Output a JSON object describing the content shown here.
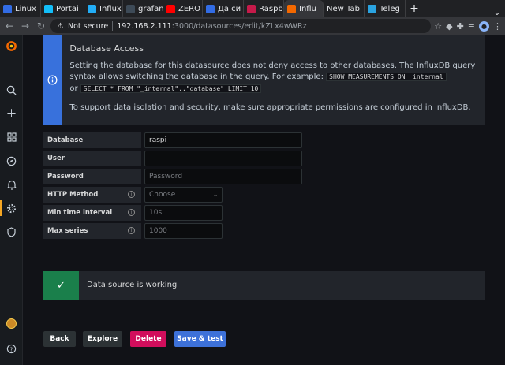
{
  "browser": {
    "tabs": [
      {
        "label": "Linux",
        "icon": "k8s-icon",
        "color": "#326ce5"
      },
      {
        "label": "Portai",
        "icon": "portainer-icon",
        "color": "#13bef9"
      },
      {
        "label": "Influx",
        "icon": "influx-icon",
        "color": "#22adf6"
      },
      {
        "label": "grafan",
        "icon": "grafana-icon",
        "color": "#3d4a57"
      },
      {
        "label": "ZERO",
        "icon": "youtube-icon",
        "color": "#ff0000"
      },
      {
        "label": "Да си",
        "icon": "k8s-icon",
        "color": "#326ce5"
      },
      {
        "label": "Raspb",
        "icon": "raspberry-icon",
        "color": "#c51a4a"
      },
      {
        "label": "Influ",
        "icon": "grafana-icon",
        "color": "#f46800"
      },
      {
        "label": "New Tab",
        "icon": "",
        "color": ""
      },
      {
        "label": "Teleg",
        "icon": "telegram-icon",
        "color": "#2aa3e0"
      }
    ],
    "new_tab_symbol": "+",
    "security_label": "Not secure",
    "url_host": "192.168.2.111",
    "url_path": ":3000/datasources/edit/kZLx4wWRz"
  },
  "info_alert": {
    "title": "Database Access",
    "line1": "Setting the database for this datasource does not deny access to other databases. The InfluxDB query syntax allows switching the database in the query. For example:",
    "code1": "SHOW MEASUREMENTS ON _internal",
    "or_text": "or",
    "code2": "SELECT * FROM \"_internal\"..\"database\" LIMIT 10",
    "line2": "To support data isolation and security, make sure appropriate permissions are configured in InfluxDB.",
    "color": "#3871dc"
  },
  "form": {
    "database": {
      "label": "Database",
      "value": "raspi"
    },
    "user": {
      "label": "User",
      "value": ""
    },
    "password": {
      "label": "Password",
      "placeholder": "Password"
    },
    "http_method": {
      "label": "HTTP Method",
      "placeholder": "Choose"
    },
    "min_time_interval": {
      "label": "Min time interval",
      "placeholder": "10s"
    },
    "max_series": {
      "label": "Max series",
      "placeholder": "1000"
    }
  },
  "success_alert": {
    "text": "Data source is working",
    "color": "#1a7f4b"
  },
  "buttons": {
    "back": "Back",
    "explore": "Explore",
    "delete": "Delete",
    "save_test": "Save & test"
  },
  "colors": {
    "accent": "#3d71d9",
    "danger": "#d10e5c",
    "active": "#f5a623"
  }
}
